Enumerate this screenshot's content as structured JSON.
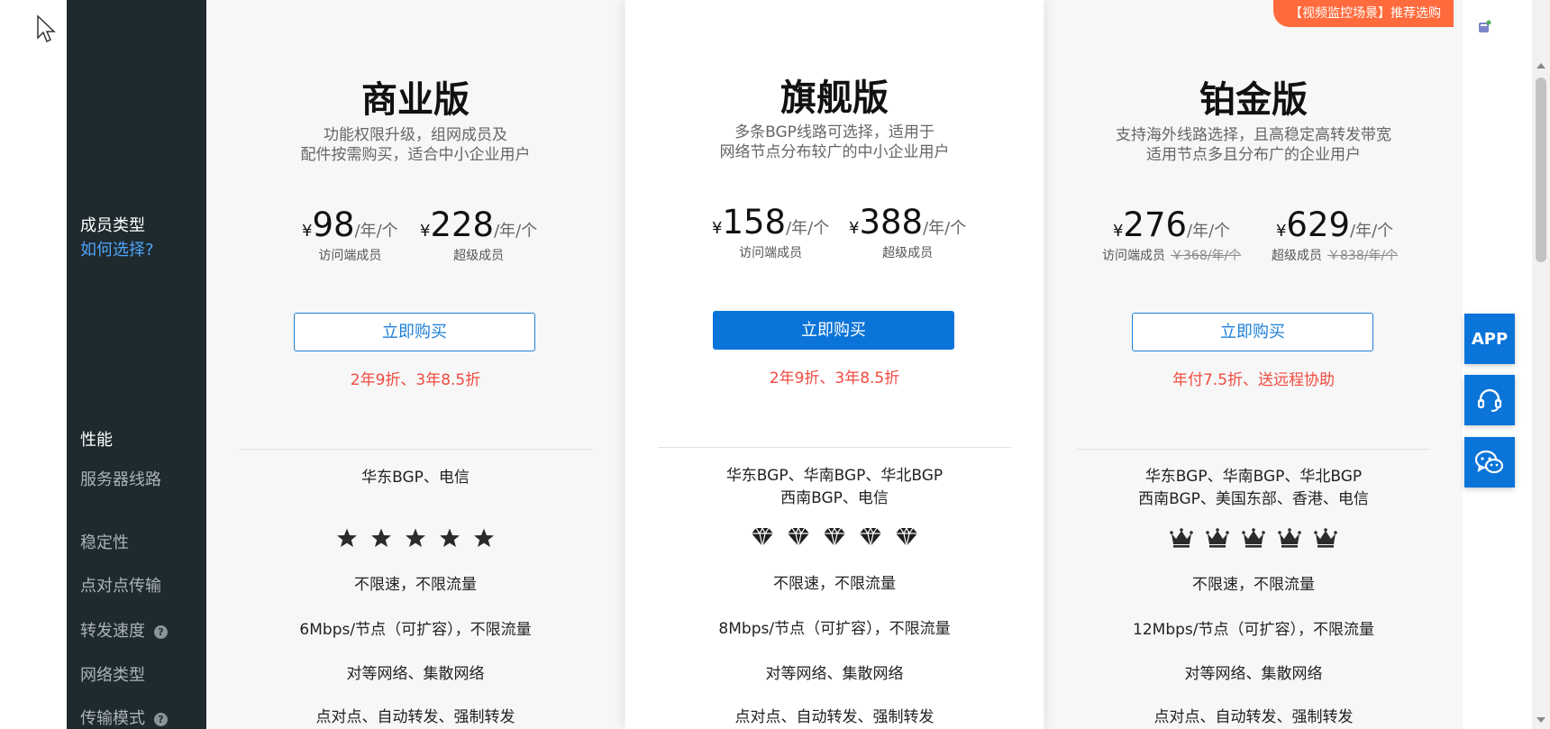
{
  "sidebar": {
    "member_type_title": "成员类型",
    "how_to_choose_link": "如何选择?",
    "performance_title": "性能",
    "rows": {
      "server_line": "服务器线路",
      "stability": "稳定性",
      "p2p": "点对点传输",
      "forward_speed": "转发速度",
      "network_type": "网络类型",
      "transfer_mode": "传输模式"
    },
    "help_glyph": "?"
  },
  "plans": [
    {
      "name": "商业版",
      "desc_line1": "功能权限升级，组网成员及",
      "desc_line2": "配件按需购买，适合中小企业用户",
      "price1": {
        "currency": "¥",
        "value": "98",
        "unit": "/年/个",
        "label": "访问端成员",
        "original": ""
      },
      "price2": {
        "currency": "¥",
        "value": "228",
        "unit": "/年/个",
        "label": "超级成员",
        "original": ""
      },
      "buy_label": "立即购买",
      "discount": "2年9折、3年8.5折",
      "server_line_1": "华东BGP、电信",
      "server_line_2": "",
      "rating_icon": "star-icon",
      "rating": 5,
      "p2p": "不限速，不限流量",
      "forward_speed": "6Mbps/节点（可扩容），不限流量",
      "network_type": "对等网络、集散网络",
      "transfer_mode": "点对点、自动转发、强制转发"
    },
    {
      "name": "旗舰版",
      "desc_line1": "多条BGP线路可选择，适用于",
      "desc_line2": "网络节点分布较广的中小企业用户",
      "price1": {
        "currency": "¥",
        "value": "158",
        "unit": "/年/个",
        "label": "访问端成员",
        "original": ""
      },
      "price2": {
        "currency": "¥",
        "value": "388",
        "unit": "/年/个",
        "label": "超级成员",
        "original": ""
      },
      "buy_label": "立即购买",
      "discount": "2年9折、3年8.5折",
      "server_line_1": "华东BGP、华南BGP、华北BGP",
      "server_line_2": "西南BGP、电信",
      "rating_icon": "diamond-icon",
      "rating": 5,
      "p2p": "不限速，不限流量",
      "forward_speed": "8Mbps/节点（可扩容），不限流量",
      "network_type": "对等网络、集散网络",
      "transfer_mode": "点对点、自动转发、强制转发"
    },
    {
      "name": "铂金版",
      "desc_line1": "支持海外线路选择，且高稳定高转发带宽",
      "desc_line2": "适用节点多且分布广的企业用户",
      "price1": {
        "currency": "¥",
        "value": "276",
        "unit": "/年/个",
        "label": "访问端成员",
        "original": "￥368/年/个"
      },
      "price2": {
        "currency": "¥",
        "value": "629",
        "unit": "/年/个",
        "label": "超级成员",
        "original": "￥838/年/个"
      },
      "buy_label": "立即购买",
      "discount": "年付7.5折、送远程协助",
      "server_line_1": "华东BGP、华南BGP、华北BGP",
      "server_line_2": "西南BGP、美国东部、香港、电信",
      "rating_icon": "crown-icon",
      "rating": 5,
      "p2p": "不限速，不限流量",
      "forward_speed": "12Mbps/节点（可扩容），不限流量",
      "network_type": "对等网络、集散网络",
      "transfer_mode": "点对点、自动转发、强制转发"
    }
  ],
  "badge": "【视频监控场景】推荐选购",
  "float_buttons": {
    "app_label": "APP",
    "support_icon": "headset-icon",
    "wechat_icon": "wechat-icon"
  },
  "colors": {
    "sidebar_bg": "#1f2a2f",
    "accent_blue": "#0a74d8",
    "discount_red": "#f04a3f",
    "badge_orange": "#ff6b3d"
  }
}
